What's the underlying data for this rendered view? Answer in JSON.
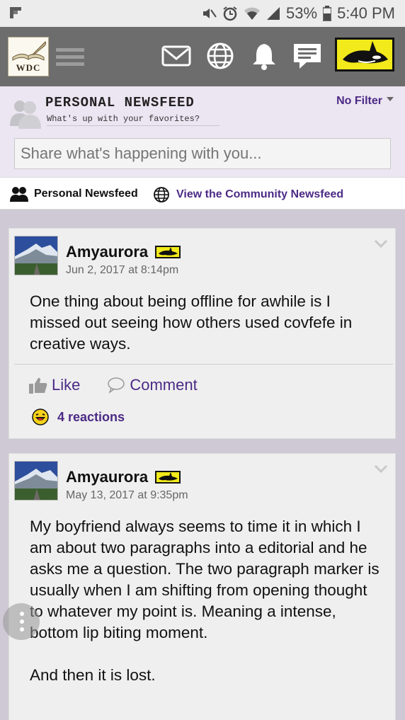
{
  "status_bar": {
    "battery": "53%",
    "time": "5:40 PM",
    "icons": [
      "flipboard-icon",
      "mute-icon",
      "alarm-icon",
      "wifi-icon",
      "signal-icon",
      "battery-icon"
    ]
  },
  "header": {
    "logo_text": "WDC",
    "icons": [
      "menu-icon",
      "mail-icon",
      "globe-icon",
      "bell-icon",
      "chat-icon",
      "orca-badge-icon"
    ]
  },
  "feed": {
    "title": "PERSONAL NEWSFEED",
    "subtitle": "What's up with your favorites?",
    "filter_label": "No Filter",
    "share_placeholder": "Share what's happening with you..."
  },
  "tabs": {
    "personal": "Personal Newsfeed",
    "community": "View the Community Newsfeed"
  },
  "posts": [
    {
      "author": "Amyaurora",
      "date": "Jun 2, 2017 at 8:14pm",
      "body": "One thing about being offline for awhile is I missed out seeing how others used covfefe in creative ways.",
      "like_label": "Like",
      "comment_label": "Comment",
      "reactions": "4 reactions"
    },
    {
      "author": "Amyaurora",
      "date": "May 13, 2017 at 9:35pm",
      "body_p1": "My boyfriend always seems to time it in which I am about two paragraphs into a editorial and he asks me a question. The two paragraph marker is usually when I am shifting from opening thought to whatever my point is. Meaning a intense, bottom lip biting moment.",
      "body_p2": "And then it is lost."
    }
  ],
  "colors": {
    "accent": "#4b2a85",
    "header_bg": "#6d6d6d",
    "badge_yellow": "#f2ea1a",
    "feed_head_bg": "#ece5f2"
  }
}
